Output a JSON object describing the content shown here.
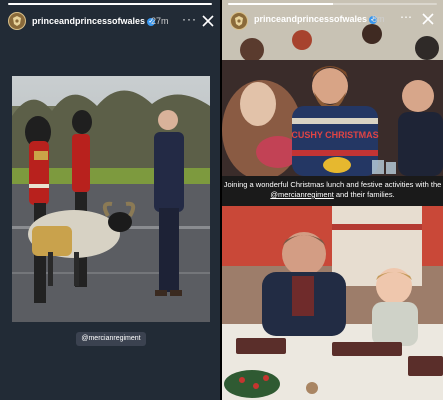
{
  "left_story": {
    "progress": 1,
    "username": "princeandprincessofwales",
    "verified": "✓",
    "time": "27m",
    "more": "···",
    "mention_tag": "@mercianregiment"
  },
  "right_story": {
    "progress": 0.5,
    "username": "princeandprincessofwales",
    "verified": "✓",
    "time": "8m",
    "sticker_text": "CUSHY CHRISTMAS",
    "caption_prefix": "Joining a wonderful Christmas lunch and festive activities with the ",
    "caption_mention": "@mercianregiment",
    "caption_suffix": " and their families."
  }
}
